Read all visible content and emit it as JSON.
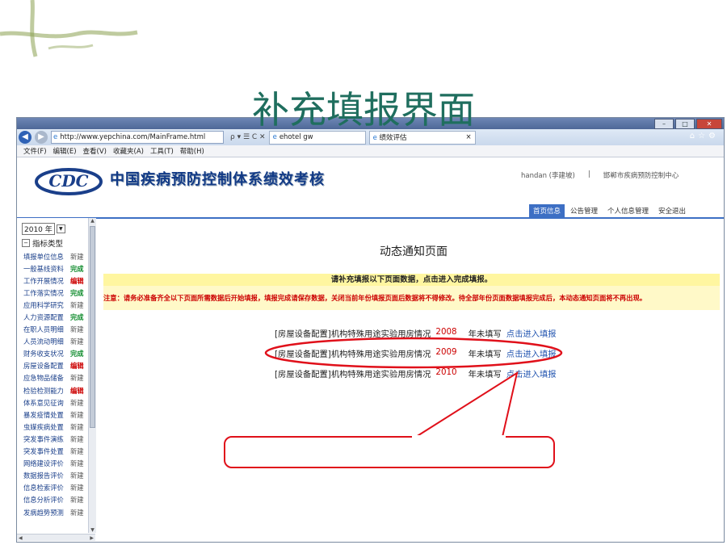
{
  "slide": {
    "title": "补充填报界面"
  },
  "browser": {
    "url": "http://www.yepchina.com/MainFrame.html",
    "url_controls": "ρ ▾ ☰ C ✕",
    "tabs": [
      {
        "label": "ehotel gw"
      },
      {
        "label": "绩效评估",
        "close": "×"
      }
    ],
    "menu": [
      "文件(F)",
      "编辑(E)",
      "查看(V)",
      "收藏夹(A)",
      "工具(T)",
      "帮助(H)"
    ]
  },
  "app": {
    "name": "中国疾病预防控制体系绩效考核",
    "user": "handan (李建坡)",
    "separator": "|",
    "org": "邯郸市疾病预防控制中心",
    "nav": [
      "首页信息",
      "公告管理",
      "个人信息管理",
      "安全退出"
    ]
  },
  "sidebar": {
    "year": "2010 年",
    "category_title": "指标类型",
    "items": [
      {
        "name": "填报单位信息",
        "status": "新建",
        "kind": "new"
      },
      {
        "name": "一般基线资料",
        "status": "完成",
        "kind": "done"
      },
      {
        "name": "工作开展情况",
        "status": "编辑",
        "kind": "edit"
      },
      {
        "name": "工作落实情况",
        "status": "完成",
        "kind": "done"
      },
      {
        "name": "应用科学研究",
        "status": "新建",
        "kind": "new"
      },
      {
        "name": "人力资源配置",
        "status": "完成",
        "kind": "done"
      },
      {
        "name": "在职人员明细",
        "status": "新建",
        "kind": "new"
      },
      {
        "name": "人员流动明细",
        "status": "新建",
        "kind": "new"
      },
      {
        "name": "财务收支状况",
        "status": "完成",
        "kind": "done"
      },
      {
        "name": "房屋设备配置",
        "status": "编辑",
        "kind": "edit"
      },
      {
        "name": "应急物品储备",
        "status": "新建",
        "kind": "new"
      },
      {
        "name": "检验检测能力",
        "status": "编辑",
        "kind": "edit"
      },
      {
        "name": "体系意见征询",
        "status": "新建",
        "kind": "new"
      },
      {
        "name": "暴发疫情处置",
        "status": "新建",
        "kind": "new"
      },
      {
        "name": "虫媒疾病处置",
        "status": "新建",
        "kind": "new"
      },
      {
        "name": "突发事件演练",
        "status": "新建",
        "kind": "new"
      },
      {
        "name": "突发事件处置",
        "status": "新建",
        "kind": "new"
      },
      {
        "name": "网络建设评价",
        "status": "新建",
        "kind": "new"
      },
      {
        "name": "数据报告评价",
        "status": "新建",
        "kind": "new"
      },
      {
        "name": "信息检索评价",
        "status": "新建",
        "kind": "new"
      },
      {
        "name": "信息分析评价",
        "status": "新建",
        "kind": "new"
      },
      {
        "name": "发病趋势预测",
        "status": "新建",
        "kind": "new"
      }
    ]
  },
  "main": {
    "title": "动态通知页面",
    "prompt": "请补充填报以下页面数据，点击进入完成填报。",
    "notice": "注意：请务必准备齐全以下页面所需数据后开始填报，填报完成请保存数据，关闭当前年份填报页面后数据将不得修改。待全部年份页面数据填报完成后，本动态通知页面将不再出现。",
    "records": [
      {
        "text": "[房屋设备配置]机构特殊用途实验用房情况",
        "year": "2008",
        "state": "年未填写",
        "link": "点击进入填报"
      },
      {
        "text": "[房屋设备配置]机构特殊用途实验用房情况",
        "year": "2009",
        "state": "年未填写",
        "link": "点击进入填报"
      },
      {
        "text": "[房屋设备配置]机构特殊用途实验用房情况",
        "year": "2010",
        "state": "年未填写",
        "link": "点击进入填报"
      }
    ]
  },
  "colors": {
    "accent": "#3d6fc4",
    "annotation": "#e0101a",
    "title": "#1f6e5e"
  }
}
